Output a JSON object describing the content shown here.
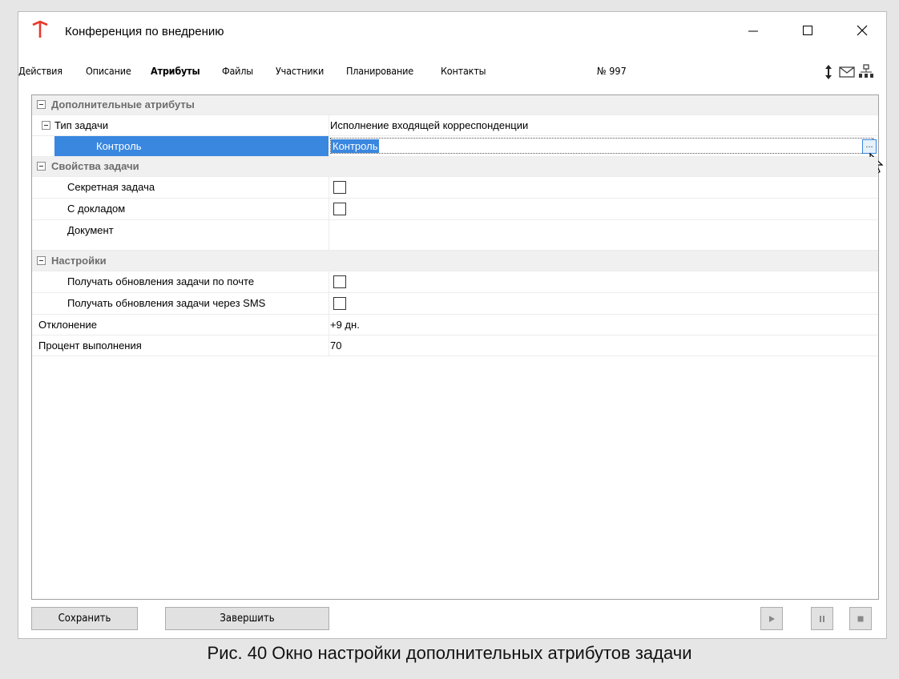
{
  "window": {
    "title": "Конференция по внедрению"
  },
  "menu": {
    "items": [
      "Действия",
      "Описание",
      "Атрибуты",
      "Файлы",
      "Участники",
      "Планирование",
      "Контакты"
    ],
    "active": "Атрибуты",
    "number_label": "№ 997"
  },
  "grid": {
    "cat1": "Дополнительные атрибуты",
    "task_type_name": "Тип задачи",
    "task_type_value": "Исполнение входящей корреспонденции",
    "control_name": "Контроль",
    "control_value": "Контроль",
    "cat2": "Свойства задачи",
    "secret_name": "Секретная задача",
    "report_name": "С докладом",
    "document_name": "Документ",
    "cat3": "Настройки",
    "mail_updates_name": "Получать обновления задачи по почте",
    "sms_updates_name": "Получать обновления задачи через SMS",
    "deviation_name": "Отклонение",
    "deviation_value": "+9 дн.",
    "percent_name": "Процент выполнения",
    "percent_value": "70",
    "ellipsis": "...",
    "checkboxes": {
      "secret": false,
      "report": false,
      "mail": false,
      "sms": false
    }
  },
  "buttons": {
    "save": "Сохранить",
    "finish": "Завершить"
  },
  "caption": "Рис. 40 Окно настройки дополнительных атрибутов задачи",
  "colors": {
    "selection": "#3a87e0",
    "app_icon": "#e8392b"
  }
}
